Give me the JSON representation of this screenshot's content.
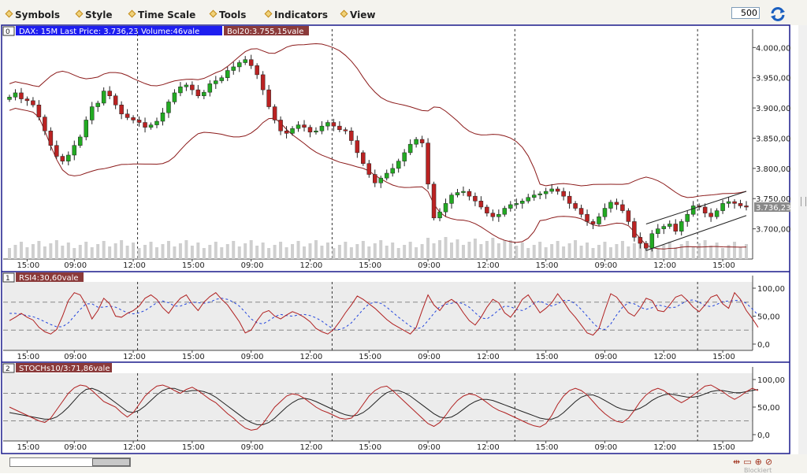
{
  "menu": {
    "items": [
      "Symbols",
      "Style",
      "Time Scale",
      "Tools",
      "Indicators",
      "View"
    ],
    "bars_value": "500"
  },
  "panels": {
    "main": {
      "index": "0",
      "title": "DAX: 15M Last Price: 3.736,23 Volume:46vale",
      "overlay": "Bol20:3.755,15vale",
      "price_badge": "3.736,23",
      "y_ticks": [
        "4.000,00",
        "3.950,00",
        "3.900,00",
        "3.850,00",
        "3.800,00",
        "3.750,00",
        "3.700,00"
      ]
    },
    "rsi": {
      "index": "1",
      "title": "RSI4:30,60vale",
      "y_ticks": [
        "100,00",
        "50,00",
        "0,0"
      ]
    },
    "stoch": {
      "index": "2",
      "title": "STOCHs10/3:71,86vale",
      "y_ticks": [
        "100,00",
        "50,00",
        "0,0"
      ]
    }
  },
  "x_labels": [
    "15:00",
    "09:00",
    "12:00",
    "15:00",
    "09:00",
    "12:00",
    "15:00",
    "09:00",
    "12:00",
    "15:00",
    "09:00",
    "12:00",
    "15:00"
  ],
  "status": {
    "corner": "Blockiert"
  },
  "colors": {
    "up": "#22aa22",
    "down": "#bb2222",
    "band": "#8b1a1a",
    "header_active": "#1e1ef0",
    "header_overlay": "#8b3a3a",
    "frame": "#1a1a8c"
  },
  "chart_data": {
    "type": "candlestick",
    "price_ylim": [
      3650,
      4020
    ],
    "close": [
      3918,
      3925,
      3915,
      3912,
      3905,
      3885,
      3862,
      3838,
      3820,
      3812,
      3822,
      3838,
      3852,
      3880,
      3902,
      3908,
      3928,
      3920,
      3905,
      3890,
      3884,
      3880,
      3876,
      3868,
      3872,
      3878,
      3892,
      3910,
      3925,
      3935,
      3938,
      3930,
      3920,
      3926,
      3940,
      3945,
      3950,
      3962,
      3968,
      3975,
      3980,
      3970,
      3955,
      3930,
      3902,
      3880,
      3862,
      3858,
      3866,
      3872,
      3868,
      3860,
      3862,
      3870,
      3876,
      3870,
      3864,
      3862,
      3846,
      3826,
      3808,
      3790,
      3776,
      3784,
      3792,
      3800,
      3812,
      3826,
      3840,
      3848,
      3842,
      3774,
      3718,
      3728,
      3742,
      3756,
      3760,
      3762,
      3754,
      3746,
      3736,
      3726,
      3720,
      3724,
      3734,
      3740,
      3742,
      3746,
      3752,
      3756,
      3758,
      3762,
      3766,
      3762,
      3754,
      3742,
      3734,
      3724,
      3712,
      3708,
      3720,
      3734,
      3744,
      3740,
      3730,
      3712,
      3686,
      3676,
      3668,
      3692,
      3700,
      3704,
      3708,
      3696,
      3712,
      3724,
      3738,
      3736,
      3726,
      3720,
      3730,
      3742,
      3745,
      3742,
      3738,
      3736
    ],
    "rsi": [
      42,
      48,
      55,
      48,
      43,
      30,
      22,
      18,
      26,
      50,
      78,
      92,
      88,
      70,
      45,
      60,
      82,
      72,
      50,
      48,
      55,
      60,
      68,
      82,
      88,
      80,
      65,
      55,
      70,
      82,
      88,
      72,
      60,
      75,
      85,
      92,
      80,
      70,
      55,
      40,
      20,
      25,
      42,
      56,
      60,
      50,
      45,
      52,
      58,
      54,
      48,
      40,
      28,
      22,
      18,
      26,
      40,
      56,
      70,
      86,
      80,
      72,
      64,
      54,
      44,
      36,
      30,
      24,
      18,
      30,
      60,
      88,
      70,
      60,
      74,
      80,
      72,
      56,
      42,
      34,
      48,
      66,
      80,
      74,
      56,
      48,
      62,
      80,
      88,
      72,
      56,
      64,
      74,
      90,
      76,
      60,
      48,
      34,
      20,
      16,
      28,
      60,
      90,
      84,
      70,
      56,
      50,
      64,
      82,
      78,
      60,
      58,
      70,
      84,
      88,
      78,
      66,
      58,
      70,
      84,
      88,
      72,
      64,
      92,
      80,
      60,
      46,
      30
    ],
    "rsi_signal": [
      55,
      55,
      53,
      51,
      49,
      45,
      40,
      35,
      31,
      31,
      38,
      50,
      62,
      72,
      72,
      66,
      66,
      68,
      66,
      61,
      56,
      54,
      56,
      60,
      67,
      74,
      77,
      74,
      68,
      68,
      72,
      75,
      74,
      73,
      75,
      80,
      82,
      80,
      75,
      68,
      57,
      45,
      38,
      36,
      42,
      49,
      53,
      51,
      50,
      52,
      53,
      51,
      47,
      41,
      33,
      27,
      26,
      30,
      38,
      50,
      62,
      72,
      75,
      73,
      66,
      57,
      48,
      40,
      32,
      27,
      30,
      42,
      55,
      67,
      71,
      73,
      75,
      72,
      66,
      56,
      47,
      45,
      52,
      61,
      68,
      67,
      62,
      60,
      65,
      73,
      77,
      72,
      68,
      72,
      78,
      78,
      72,
      62,
      50,
      38,
      28,
      26,
      36,
      52,
      66,
      74,
      72,
      66,
      62,
      65,
      70,
      68,
      65,
      66,
      72,
      78,
      79,
      75,
      69,
      67,
      71,
      76,
      77,
      78,
      78,
      73,
      63,
      52
    ],
    "stoch": [
      50,
      45,
      40,
      35,
      30,
      25,
      22,
      30,
      45,
      60,
      75,
      85,
      90,
      88,
      80,
      70,
      60,
      55,
      50,
      40,
      32,
      40,
      55,
      70,
      80,
      88,
      90,
      86,
      80,
      75,
      82,
      86,
      80,
      72,
      64,
      58,
      48,
      38,
      30,
      20,
      12,
      8,
      10,
      20,
      35,
      50,
      60,
      70,
      74,
      72,
      66,
      58,
      50,
      44,
      40,
      35,
      30,
      28,
      30,
      40,
      55,
      70,
      80,
      86,
      88,
      80,
      70,
      60,
      50,
      40,
      30,
      20,
      15,
      22,
      35,
      50,
      62,
      70,
      74,
      72,
      66,
      58,
      50,
      44,
      40,
      35,
      30,
      25,
      20,
      16,
      14,
      20,
      35,
      55,
      70,
      80,
      84,
      80,
      72,
      60,
      48,
      38,
      30,
      24,
      22,
      30,
      44,
      60,
      72,
      80,
      84,
      80,
      72,
      64,
      58,
      64,
      72,
      80,
      88,
      90,
      84,
      78,
      70,
      64,
      70,
      78,
      84,
      80
    ],
    "stoch_signal": [
      40,
      38,
      36,
      34,
      32,
      30,
      28,
      28,
      32,
      40,
      50,
      62,
      74,
      82,
      84,
      80,
      74,
      66,
      58,
      50,
      42,
      40,
      44,
      52,
      62,
      72,
      80,
      84,
      84,
      80,
      78,
      80,
      80,
      78,
      74,
      68,
      60,
      52,
      44,
      36,
      28,
      22,
      18,
      18,
      22,
      30,
      40,
      50,
      58,
      64,
      66,
      64,
      60,
      55,
      50,
      45,
      40,
      36,
      34,
      35,
      40,
      48,
      58,
      68,
      76,
      80,
      80,
      76,
      70,
      62,
      54,
      46,
      38,
      32,
      30,
      32,
      38,
      46,
      54,
      60,
      64,
      64,
      62,
      58,
      54,
      50,
      46,
      42,
      38,
      34,
      30,
      28,
      28,
      32,
      40,
      50,
      60,
      68,
      72,
      72,
      68,
      62,
      56,
      50,
      46,
      44,
      44,
      48,
      54,
      62,
      68,
      72,
      74,
      72,
      70,
      68,
      68,
      70,
      74,
      78,
      80,
      80,
      78,
      76,
      76,
      78,
      80,
      82
    ],
    "x_labels": [
      "15:00",
      "09:00",
      "12:00",
      "15:00",
      "09:00",
      "12:00",
      "15:00",
      "09:00",
      "12:00",
      "15:00",
      "09:00",
      "12:00",
      "15:00"
    ]
  }
}
